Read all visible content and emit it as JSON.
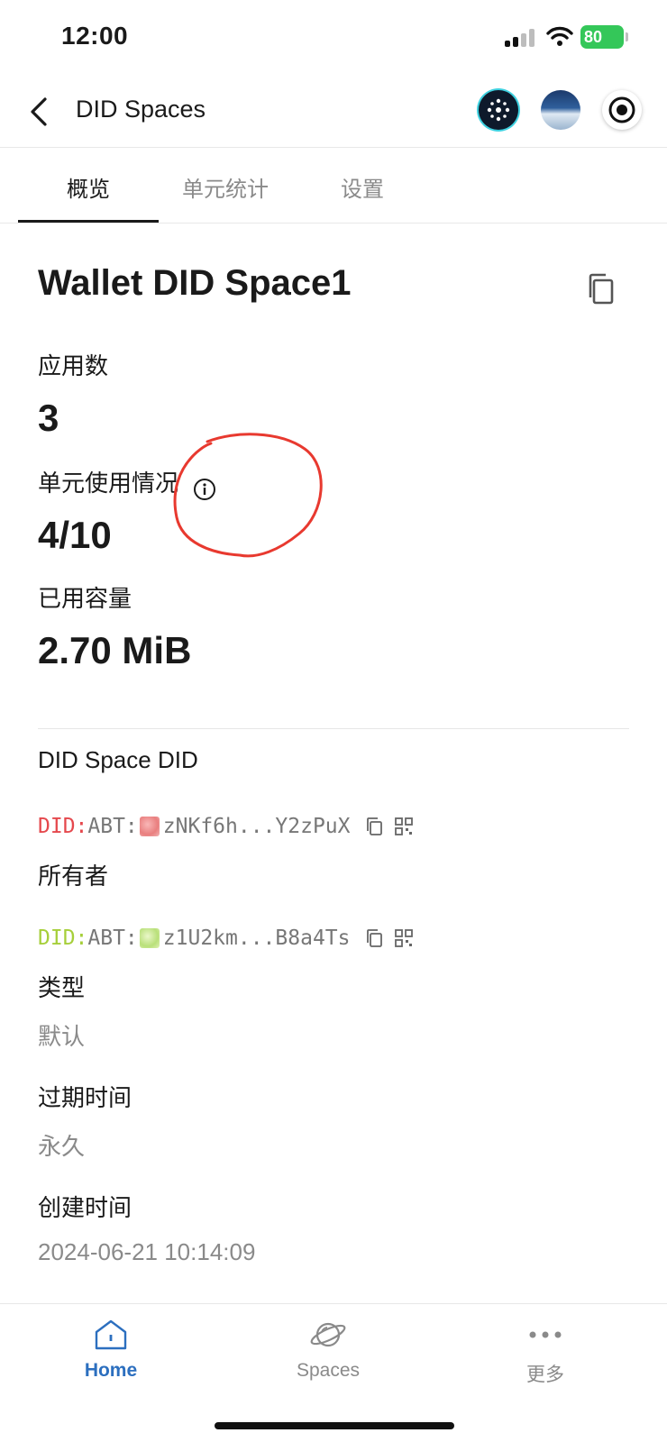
{
  "status_bar": {
    "time": "12:00",
    "battery": "80"
  },
  "header": {
    "title": "DID Spaces",
    "icons": [
      "wallet-app-icon",
      "space-avatar-icon",
      "record-icon"
    ]
  },
  "tabs": [
    {
      "label": "概览",
      "active": true
    },
    {
      "label": "单元统计",
      "active": false
    },
    {
      "label": "设置",
      "active": false
    }
  ],
  "overview": {
    "space_name": "Wallet DID Space1",
    "apps_label": "应用数",
    "apps_value": "3",
    "units_label": "单元使用情况",
    "units_value": "4/10",
    "capacity_label": "已用容量",
    "capacity_value": "2.70 MiB"
  },
  "details": {
    "space_did_label": "DID Space DID",
    "space_did_prefix": "DID:",
    "space_did_chain": "ABT:",
    "space_did_value": "zNKf6h...Y2zPuX",
    "owner_label": "所有者",
    "owner_did_prefix": "DID:",
    "owner_did_chain": "ABT:",
    "owner_did_value": "z1U2km...B8a4Ts",
    "type_label": "类型",
    "type_value": "默认",
    "expiry_label": "过期时间",
    "expiry_value": "永久",
    "created_label": "创建时间",
    "created_value": "2024-06-21 10:14:09"
  },
  "bottom_nav": [
    {
      "label": "Home",
      "icon": "home-icon",
      "active": true
    },
    {
      "label": "Spaces",
      "icon": "planet-icon",
      "active": false
    },
    {
      "label": "更多",
      "icon": "more-icon",
      "active": false
    }
  ],
  "colors": {
    "accent": "#2c6fbf",
    "did_red": "#e5484d",
    "did_green": "#a6cf3a",
    "annotation": "#e8392f",
    "battery": "#34c759"
  }
}
